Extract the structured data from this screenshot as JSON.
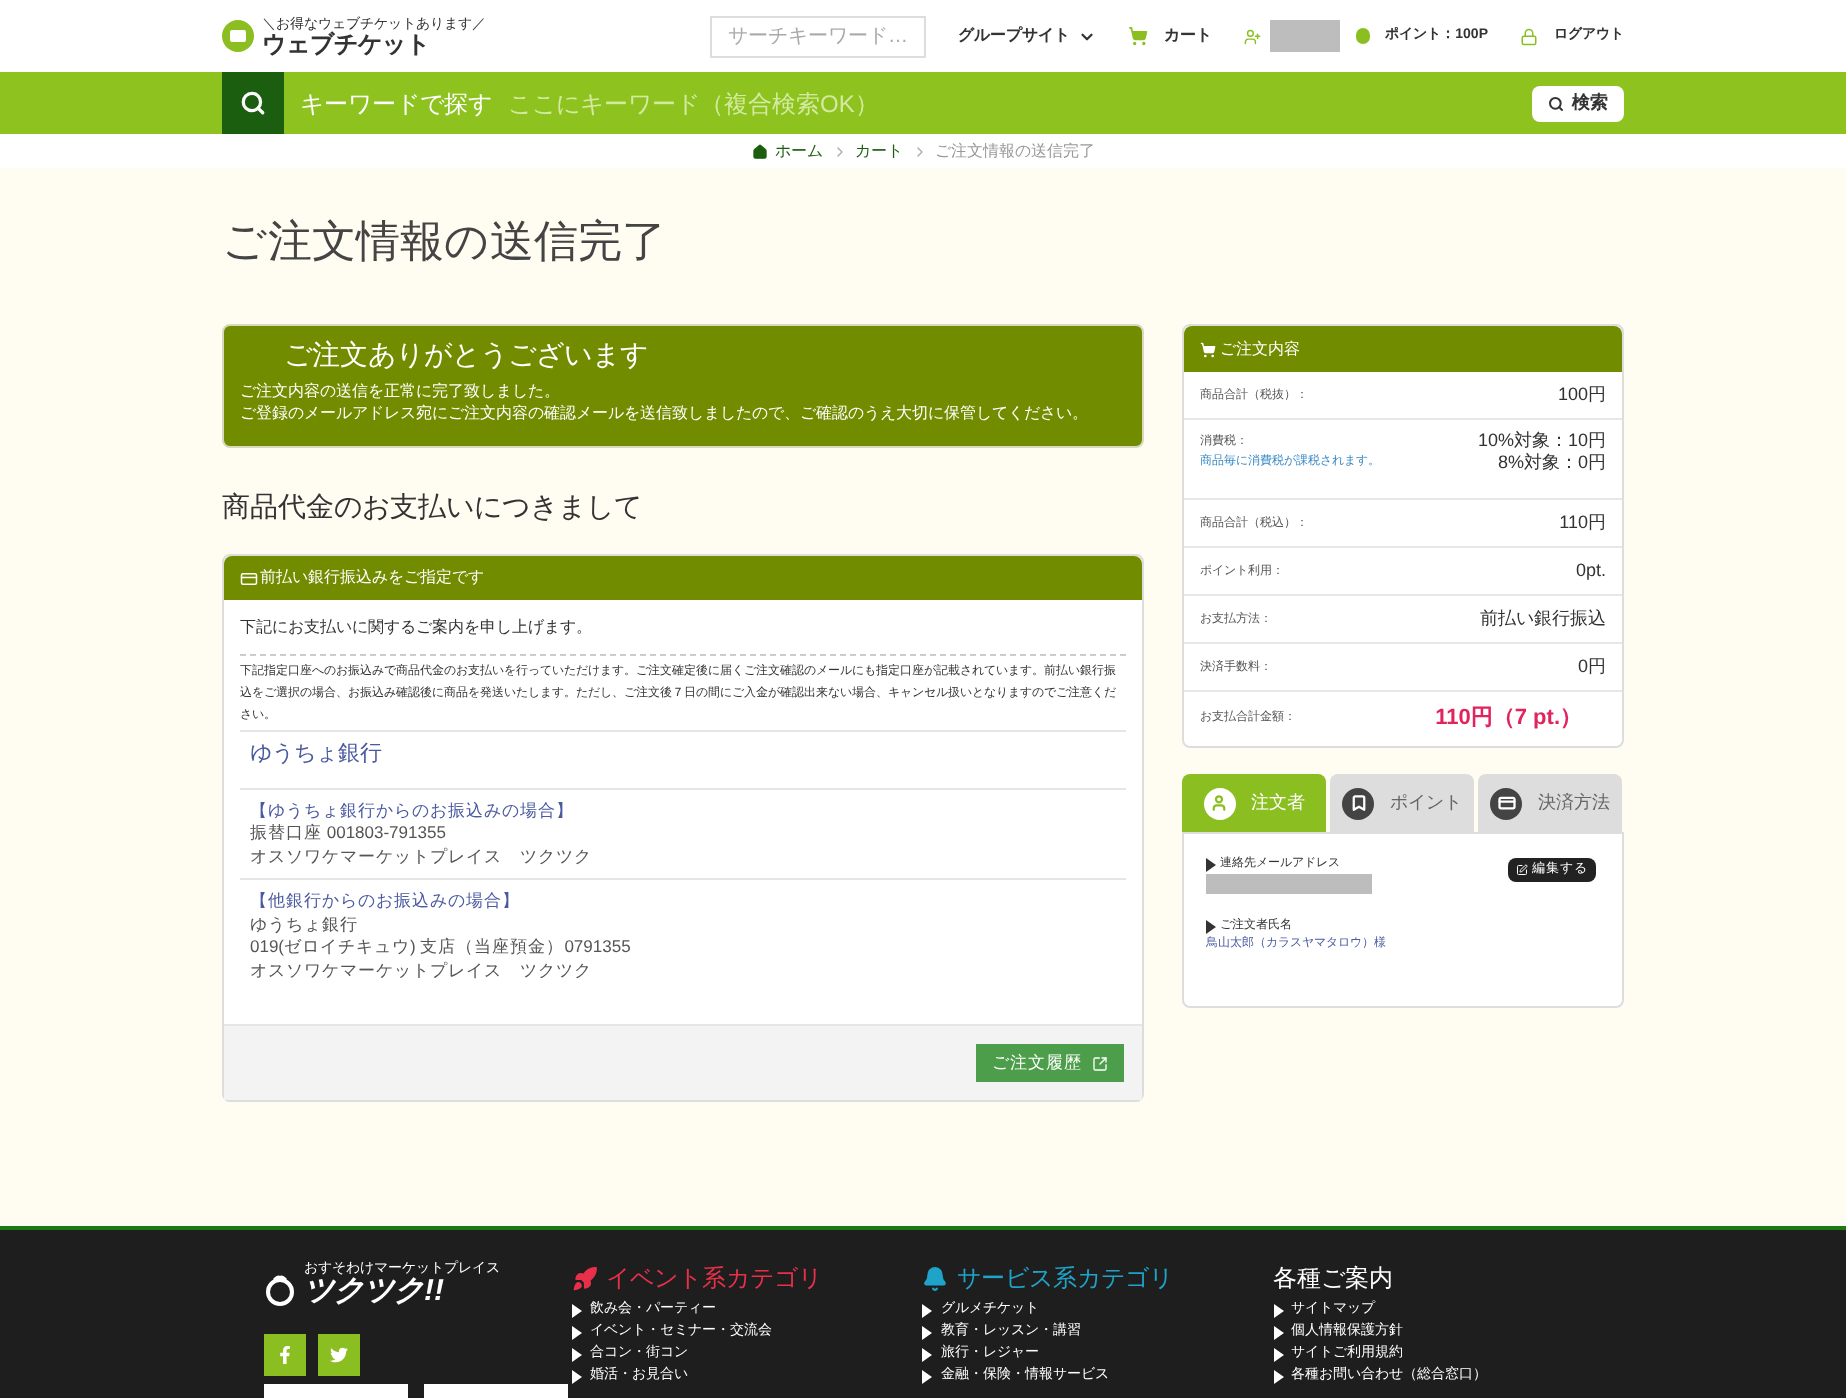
{
  "header": {
    "logo": {
      "tagline": "＼お得なウェブチケットあります／",
      "name": "ウェブチケット"
    },
    "search": {
      "placeholder": "サーチキーワード…"
    },
    "group_site": "グループサイト",
    "cart": "カート",
    "points": "ポイント：100P",
    "logout": "ログアウト"
  },
  "keyword_bar": {
    "label": "キーワードで探す",
    "placeholder": "ここにキーワード（複合検索OK）",
    "button": "検索"
  },
  "breadcrumb": [
    "ホーム",
    "カート",
    "ご注文情報の送信完了"
  ],
  "page_title": "ご注文情報の送信完了",
  "thanks": {
    "title": "ご注文ありがとうございます",
    "lines": [
      "ご注文内容の送信を正常に完了致しました。",
      "ご登録のメールアドレス宛にご注文内容の確認メールを送信致しましたので、ご確認のうえ大切に保管してください。"
    ]
  },
  "section_heading": "商品代金のお支払いにつきまして",
  "payment": {
    "header": "前払い銀行振込みをご指定です",
    "intro": "下記にお支払いに関するご案内を申し上げます。",
    "notice": "下記指定口座へのお振込みで商品代金のお支払いを行っていただけます。ご注文確定後に届くご注文確認のメールにも指定口座が記載されています。前払い銀行振込をご選択の場合、お振込み確認後に商品を発送いたします。ただし、ご注文後７日の間にご入金が確認出来ない場合、キャンセル扱いとなりますのでご注意ください。",
    "bank_name": "ゆうちょ銀行",
    "blocks": [
      {
        "heading": "【ゆうちょ銀行からのお振込みの場合】",
        "lines": [
          "振替口座 001803-791355",
          "オスソワケマーケットプレイス　ツクツク"
        ]
      },
      {
        "heading": "【他銀行からのお振込みの場合】",
        "lines": [
          "ゆうちょ銀行",
          "019(ゼロイチキュウ) 支店（当座預金）0791355",
          "オスソワケマーケットプレイス　ツクツク"
        ]
      }
    ],
    "button": "ご注文履歴"
  },
  "order_summary": {
    "title": "ご注文内容",
    "rows": [
      {
        "label": "商品合計（税抜）：",
        "values": [
          "100円"
        ]
      },
      {
        "label": "消費税：",
        "note": "商品毎に消費税が課税されます。",
        "values": [
          "10%対象：10円",
          "8%対象：0円"
        ]
      },
      {
        "label": "商品合計（税込）：",
        "values": [
          "110円"
        ]
      },
      {
        "label": "ポイント利用：",
        "values": [
          "0pt."
        ]
      },
      {
        "label": "お支払方法：",
        "values": [
          "前払い銀行振込"
        ]
      },
      {
        "label": "決済手数料：",
        "values": [
          "0円"
        ]
      }
    ],
    "total": {
      "label": "お支払合計金額：",
      "value": "110円（7 pt.）"
    }
  },
  "tabs": [
    {
      "label": "注文者",
      "kind": "user",
      "selected": true
    },
    {
      "label": "ポイント",
      "kind": "bookmark",
      "selected": false
    },
    {
      "label": "決済方法",
      "kind": "card",
      "selected": false
    }
  ],
  "orderer": {
    "edit_button": "編集する",
    "fields": [
      {
        "label": "連絡先メールアドレス",
        "kind": "redacted"
      },
      {
        "label": "ご注文者氏名",
        "kind": "text",
        "value": "鳥山太郎（カラスヤマタロウ）様"
      }
    ]
  },
  "footer": {
    "logo": {
      "tagline": "おすそわけマーケットプレイス",
      "name": "ツクツク!!"
    },
    "columns": [
      {
        "title": "イベント系カテゴリ",
        "kind": "rocket",
        "color": "#e8304a",
        "items": [
          "飲み会・パーティー",
          "イベント・セミナー・交流会",
          "合コン・街コン",
          "婚活・お見合い"
        ]
      },
      {
        "title": "サービス系カテゴリ",
        "kind": "bell",
        "color": "#1fa3c9",
        "items": [
          "グルメチケット",
          "教育・レッスン・講習",
          "旅行・レジャー",
          "金融・保険・情報サービス"
        ]
      },
      {
        "title": "各種ご案内",
        "kind": "plain",
        "color": "#ffffff",
        "items": [
          "サイトマップ",
          "個人情報保護方針",
          "サイトご利用規約",
          "各種お問い合わせ（総合窓口）"
        ]
      }
    ]
  }
}
